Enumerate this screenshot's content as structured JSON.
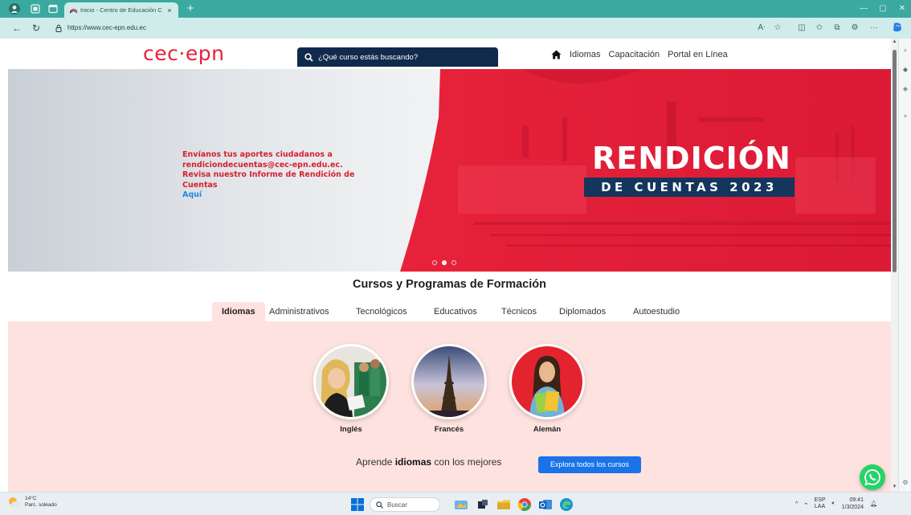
{
  "browser": {
    "tab_title": "Inicio - Centro de Educación Cor",
    "tab_close": "×",
    "new_tab": "+",
    "url": "https://www.cec-epn.edu.ec"
  },
  "site": {
    "logo": "cec·epn",
    "search_placeholder": "¿Qué curso estás buscando?",
    "nav": [
      "Idiomas",
      "Capacitación",
      "Portal en Línea"
    ]
  },
  "hero": {
    "message": "Envíanos tus aportes ciudadanos a rendiciondecuentas@cec-epn.edu.ec. Revisa nuestro Informe de Rendición de Cuentas",
    "link": "Aquí",
    "title": "RENDICIÓN",
    "subtitle": "DE CUENTAS 2023",
    "slide_count": 3,
    "active_slide": 2
  },
  "programs": {
    "title": "Cursos y Programas de Formación",
    "tabs": [
      "Idiomas",
      "Administrativos",
      "Tecnológicos",
      "Educativos",
      "Técnicos",
      "Diplomados",
      "Autoestudio"
    ],
    "active_tab": "Idiomas",
    "courses": [
      "Inglés",
      "Francés",
      "Alemán"
    ],
    "tagline_pre": "Aprende ",
    "tagline_bold": "idiomas",
    "tagline_post": " con los mejores",
    "explore_button": "Explora todos los cursos"
  },
  "taskbar": {
    "weather_temp": "14°C",
    "weather_desc": "Parc. soleado",
    "search": "Buscar",
    "lang_1": "ESP",
    "lang_2": "LAA",
    "time": "09:41",
    "date": "1/3/2024"
  },
  "colors": {
    "brand_red": "#e5213b",
    "navy": "#14355c",
    "panel_pink": "#fde2df",
    "browser_teal": "#3aa99f",
    "button_blue": "#1a73e8"
  }
}
